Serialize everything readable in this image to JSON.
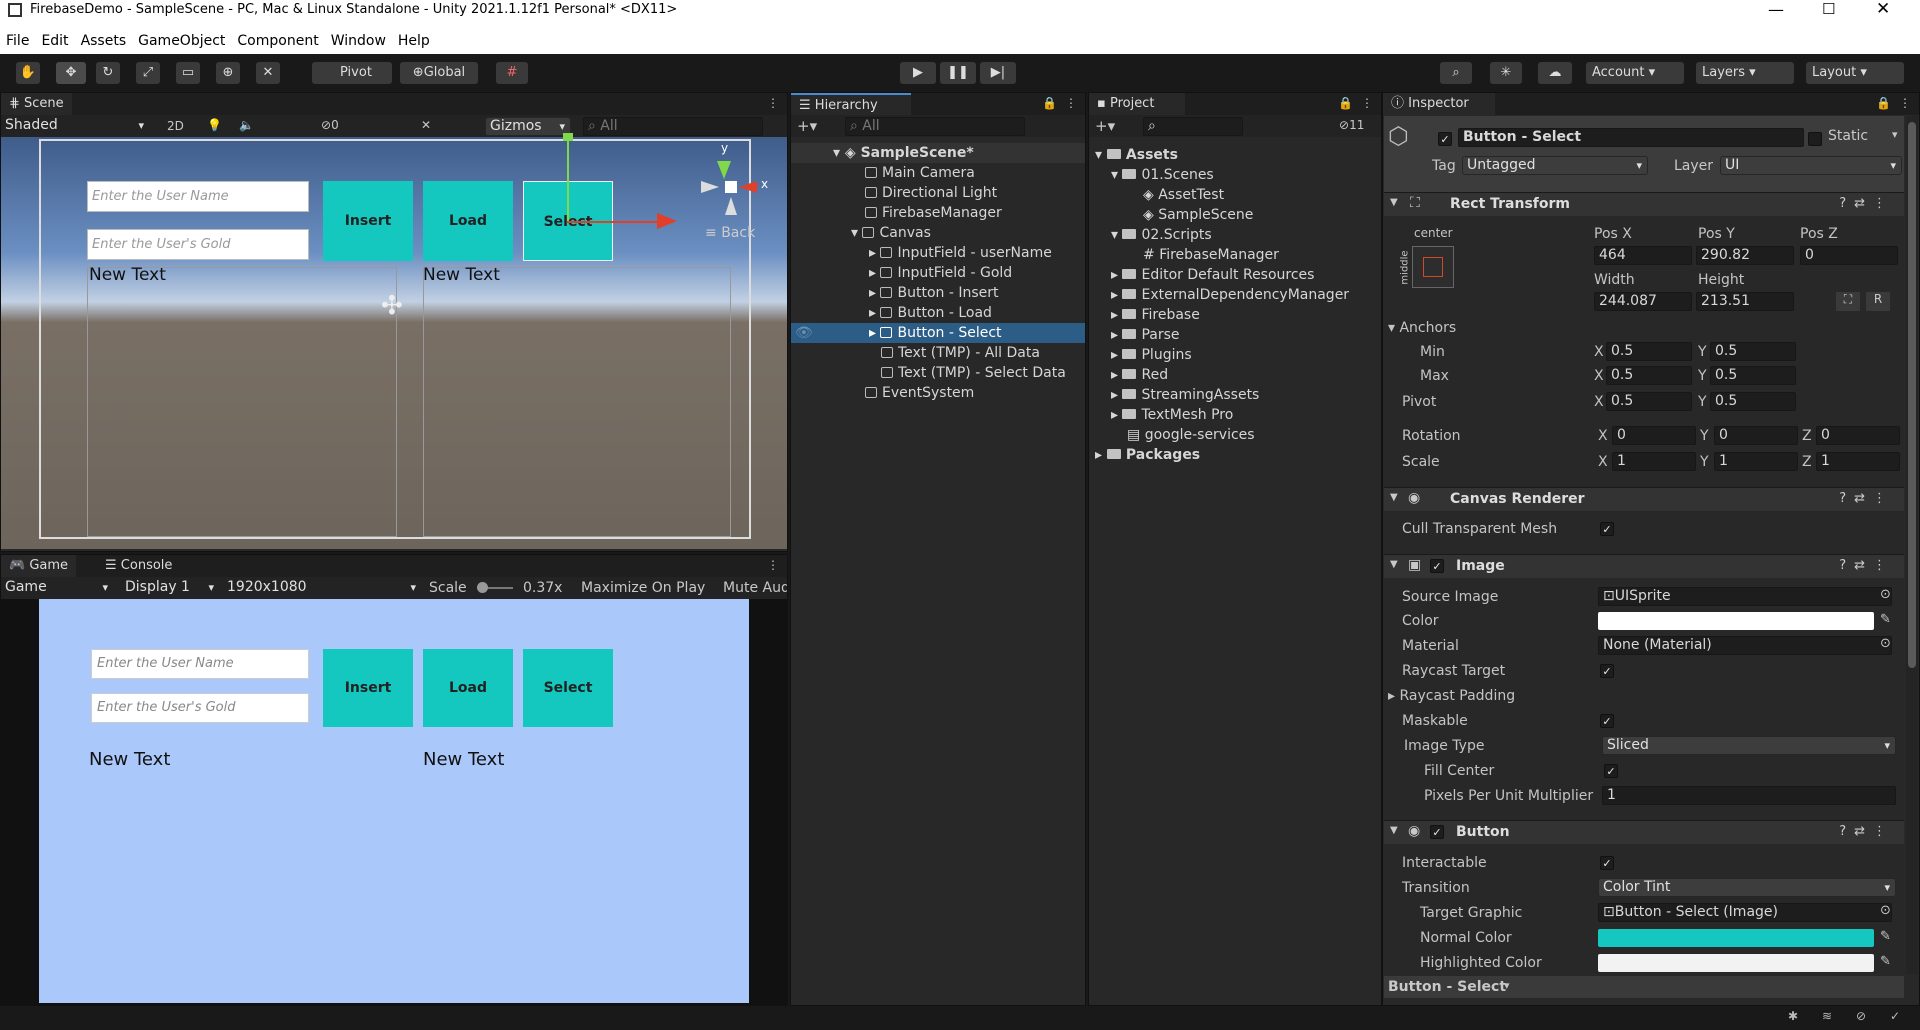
{
  "window": {
    "title": "FirebaseDemo - SampleScene - PC, Mac & Linux Standalone - Unity 2021.1.12f1 Personal* <DX11>"
  },
  "menu": [
    "File",
    "Edit",
    "Assets",
    "GameObject",
    "Component",
    "Window",
    "Help"
  ],
  "toolbar": {
    "pivot": "Pivot",
    "global": "Global",
    "account": "Account",
    "layers": "Layers",
    "layout": "Layout"
  },
  "scene": {
    "tab": "Scene",
    "shading": "Shaded",
    "twod": "2D",
    "hidden_count": "0",
    "gizmos": "Gizmos",
    "search": "All",
    "axis_y": "y",
    "axis_x": "x",
    "back": "Back",
    "ui": {
      "user_placeholder": "Enter the User Name",
      "gold_placeholder": "Enter the User's Gold",
      "insert": "Insert",
      "load": "Load",
      "select": "Select",
      "newtext1": "New Text",
      "newtext2": "New Text"
    }
  },
  "game": {
    "tab": "Game",
    "console_tab": "Console",
    "mode": "Game",
    "display": "Display 1",
    "resolution": "1920x1080",
    "scale_label": "Scale",
    "scale_value": "0.37x",
    "maximize": "Maximize On Play",
    "mute": "Mute Aud"
  },
  "hierarchy": {
    "tab": "Hierarchy",
    "search": "All",
    "items": [
      {
        "label": "SampleScene*"
      },
      {
        "label": "Main Camera"
      },
      {
        "label": "Directional Light"
      },
      {
        "label": "FirebaseManager"
      },
      {
        "label": "Canvas"
      },
      {
        "label": "InputField - userName"
      },
      {
        "label": "InputField - Gold"
      },
      {
        "label": "Button - Insert"
      },
      {
        "label": "Button - Load"
      },
      {
        "label": "Button - Select"
      },
      {
        "label": "Text (TMP) - All Data"
      },
      {
        "label": "Text (TMP) - Select Data"
      },
      {
        "label": "EventSystem"
      }
    ]
  },
  "project": {
    "tab": "Project",
    "badge": "11",
    "items": [
      {
        "label": "Assets"
      },
      {
        "label": "01.Scenes"
      },
      {
        "label": "AssetTest"
      },
      {
        "label": "SampleScene"
      },
      {
        "label": "02.Scripts"
      },
      {
        "label": "FirebaseManager"
      },
      {
        "label": "Editor Default Resources"
      },
      {
        "label": "ExternalDependencyManager"
      },
      {
        "label": "Firebase"
      },
      {
        "label": "Parse"
      },
      {
        "label": "Plugins"
      },
      {
        "label": "Red"
      },
      {
        "label": "StreamingAssets"
      },
      {
        "label": "TextMesh Pro"
      },
      {
        "label": "google-services"
      },
      {
        "label": "Packages"
      }
    ]
  },
  "inspector": {
    "tab": "Inspector",
    "object_name": "Button - Select",
    "static": "Static",
    "tag_label": "Tag",
    "tag_value": "Untagged",
    "layer_label": "Layer",
    "layer_value": "UI",
    "rect": {
      "title": "Rect Transform",
      "anchor_preset": "center",
      "anchor_side": "middle",
      "posx_label": "Pos X",
      "posy_label": "Pos Y",
      "posz_label": "Pos Z",
      "posx": "464",
      "posy": "290.82",
      "posz": "0",
      "width_label": "Width",
      "height_label": "Height",
      "width": "244.087",
      "height": "213.51",
      "anchors": "Anchors",
      "min": "Min",
      "max": "Max",
      "pivot": "Pivot",
      "min_x": "0.5",
      "min_y": "0.5",
      "max_x": "0.5",
      "max_y": "0.5",
      "pivot_x": "0.5",
      "pivot_y": "0.5",
      "rotation": "Rotation",
      "scale": "Scale",
      "rot_x": "0",
      "rot_y": "0",
      "rot_z": "0",
      "scale_x": "1",
      "scale_y": "1",
      "scale_z": "1",
      "X": "X",
      "Y": "Y",
      "Z": "Z",
      "R": "R"
    },
    "canvas_renderer": {
      "title": "Canvas Renderer",
      "cull": "Cull Transparent Mesh"
    },
    "image": {
      "title": "Image",
      "source_image": "Source Image",
      "source_value": "UISprite",
      "color": "Color",
      "material": "Material",
      "material_value": "None (Material)",
      "raycast_target": "Raycast Target",
      "raycast_padding": "Raycast Padding",
      "maskable": "Maskable",
      "image_type": "Image Type",
      "image_type_value": "Sliced",
      "fill_center": "Fill Center",
      "ppu": "Pixels Per Unit Multiplier",
      "ppu_value": "1"
    },
    "button": {
      "title": "Button",
      "interactable": "Interactable",
      "transition": "Transition",
      "transition_value": "Color Tint",
      "target_graphic": "Target Graphic",
      "target_value": "Button - Select (Image)",
      "normal_color": "Normal Color",
      "highlighted_color": "Highlighted Color"
    },
    "footer": "Button - Select"
  },
  "colors": {
    "accent": "#2c5d87",
    "teal": "#14c8c0",
    "game_bg": "#abc8fb"
  }
}
